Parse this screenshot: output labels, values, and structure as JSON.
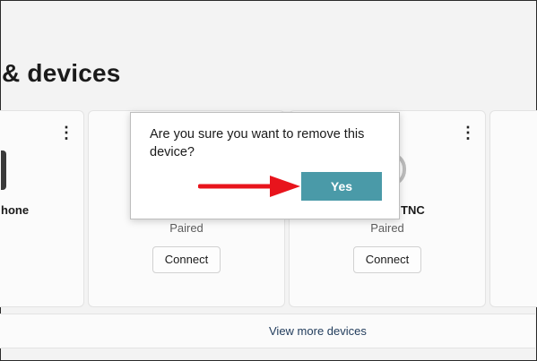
{
  "header": {
    "title": "& devices"
  },
  "devices": [
    {
      "name": "hone",
      "menu_icon": "more-vertical-icon"
    },
    {
      "status": "Paired",
      "connect_label": "Connect"
    },
    {
      "name": "TNC",
      "status": "Paired",
      "connect_label": "Connect",
      "menu_icon": "more-vertical-icon"
    },
    {}
  ],
  "footer": {
    "view_more_label": "View more devices"
  },
  "dialog": {
    "message": "Are you sure you want to remove this device?",
    "yes_label": "Yes",
    "accent": "#4a9aa8"
  },
  "annotation": {
    "arrow_color": "#e8141c",
    "arrow_icon": "arrow-right-icon"
  }
}
